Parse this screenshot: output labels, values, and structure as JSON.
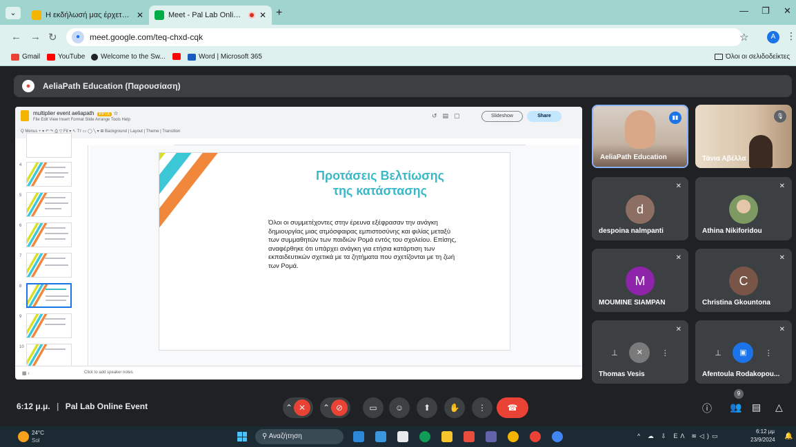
{
  "browser": {
    "tabs": [
      {
        "title": "Η εκδήλωσή μας έρχεται σύντο",
        "favicon_color": "#f4b400"
      },
      {
        "title": "Meet - Pal Lab Online Event",
        "favicon_color": "#00ac47"
      }
    ],
    "url": "meet.google.com/teq-chxd-cqk",
    "profile_initial": "A",
    "bookmarks": [
      {
        "label": "Gmail",
        "color": "#ea4335"
      },
      {
        "label": "YouTube",
        "color": "#ff0000"
      },
      {
        "label": "Welcome to the Sw...",
        "color": "#202124"
      },
      {
        "label": "",
        "color": "#ff0000"
      },
      {
        "label": "Word | Microsoft 365",
        "color": "#185abd"
      }
    ],
    "all_bookmarks_label": "Όλοι οι σελιδοδείκτες"
  },
  "meet": {
    "presenter_label": "AeliaPath Education (Παρουσίαση)",
    "time": "6:12 μ.μ.",
    "meeting_name": "Pal Lab Online Event",
    "people_count": "9"
  },
  "slides_app": {
    "doc_title": "multiplier event aeliapath",
    "doc_badge": "PPTX",
    "menu": "File  Edit  View  Insert  Format  Slide  Arrange  Tools  Help",
    "toolbar": "Q Menus   +  ▾  ↶  ↷  ⎙  ▽  Fit   ▾   ↖  Tт  ▭  ◯  ╲ ▾  ⊞   Background  |  Layout  |  Theme  |  Transition",
    "slideshow_label": "Slideshow",
    "share_label": "Share",
    "notes_placeholder": "Click to add speaker notes",
    "thumbnails": [
      "4",
      "5",
      "6",
      "7",
      "8",
      "9",
      "10"
    ],
    "selected_thumbnail": "8",
    "slide": {
      "title_line1": "Προτάσεις Βελτίωσης",
      "title_line2": "της κατάστασης",
      "body": "Όλοι οι συμμετέχοντες στην έρευνα εξέφρασαν την ανάγκη δημιουργίας μιας ατμόσφαιρας εμπιστοσύνης και φιλίας μεταξύ των συμμαθητών των παιδιών Ρομά εντός του σχολείου. Επίσης, αναφέρθηκε ότι υπάρχει ανάγκη για ετήσια κατάρτιση των εκπαιδευτικών σχετικά με τα ζητήματα που σχετίζονται με τη ζωή των Ρομά.",
      "stripe_colors": [
        "#d8df25",
        "#3bc7d5",
        "#f0873a"
      ],
      "title_color": "#3bb8c8"
    }
  },
  "participants": [
    {
      "name": "AeliaPath Education",
      "type": "video",
      "color": "#8a6d5a"
    },
    {
      "name": "Τάνια Αβέλλα",
      "type": "video",
      "color": "#c9a78d"
    },
    {
      "name": "despoina nalmpanti",
      "type": "avatar",
      "initial": "d",
      "color": "#8d6e63"
    },
    {
      "name": "Athina Nikiforidou",
      "type": "photo",
      "color": "#a5b28c"
    },
    {
      "name": "MOUMINE SIAMPAN",
      "type": "avatar",
      "initial": "M",
      "color": "#8e24aa"
    },
    {
      "name": "Christina Gkountona",
      "type": "avatar",
      "initial": "C",
      "color": "#795548"
    },
    {
      "name": "Thomas Vesis",
      "type": "hover",
      "color": "#3c4043"
    },
    {
      "name": "Afentoula Rodakopou...",
      "type": "hover",
      "color": "#3c4043"
    }
  ],
  "taskbar": {
    "temperature": "24°C",
    "condition": "Sol",
    "search_placeholder": "Αναζήτηση",
    "lang": "ΕΛ",
    "clock_time": "6:12 μμ",
    "clock_date": "23/9/2024"
  }
}
